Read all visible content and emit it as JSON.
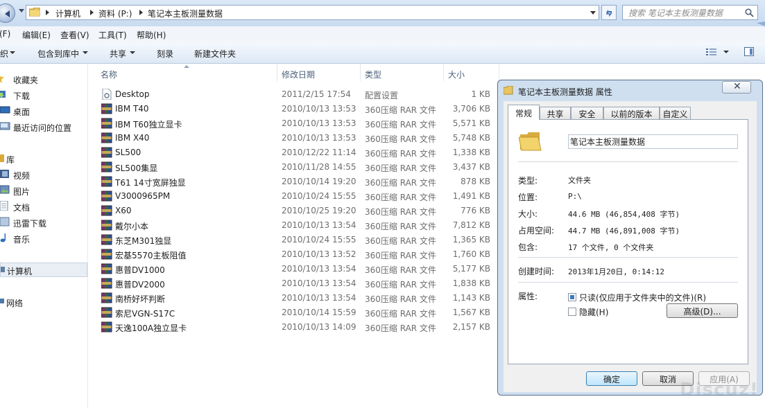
{
  "address_bar": {
    "crumbs": [
      "计算机",
      "资料 (P:)",
      "笔记本主板测量数据"
    ],
    "search_placeholder": "搜索 笔记本主板测量数据"
  },
  "menu": [
    "(F)",
    "编辑(E)",
    "查看(V)",
    "工具(T)",
    "帮助(H)"
  ],
  "commands": {
    "organize": "织",
    "include_in_library": "包含到库中",
    "share": "共享",
    "burn": "刻录",
    "new_folder": "新建文件夹"
  },
  "nav": {
    "favorites": "收藏夹",
    "downloads": "下载",
    "desktop": "桌面",
    "recent": "最近访问的位置",
    "libraries": "库",
    "videos": "视频",
    "pictures": "图片",
    "documents": "文档",
    "thunder": "迅雷下载",
    "music": "音乐",
    "computer": "计算机",
    "network": "网络"
  },
  "columns": {
    "name": "名称",
    "date": "修改日期",
    "type": "类型",
    "size": "大小"
  },
  "files": [
    {
      "name": "Desktop",
      "date": "2011/2/15 17:54",
      "type": "配置设置",
      "size": "1 KB",
      "icon": "settings-file"
    },
    {
      "name": "IBM T40",
      "date": "2010/10/13 13:53",
      "type": "360压缩 RAR 文件",
      "size": "3,706 KB",
      "icon": "rar"
    },
    {
      "name": "IBM T60独立显卡",
      "date": "2010/10/13 13:53",
      "type": "360压缩 RAR 文件",
      "size": "5,571 KB",
      "icon": "rar"
    },
    {
      "name": "IBM X40",
      "date": "2010/10/13 13:53",
      "type": "360压缩 RAR 文件",
      "size": "5,748 KB",
      "icon": "rar"
    },
    {
      "name": "SL500",
      "date": "2010/12/22 11:14",
      "type": "360压缩 RAR 文件",
      "size": "1,338 KB",
      "icon": "rar"
    },
    {
      "name": "SL500集显",
      "date": "2010/11/28 14:55",
      "type": "360压缩 RAR 文件",
      "size": "3,437 KB",
      "icon": "rar"
    },
    {
      "name": "T61 14寸宽屏独显",
      "date": "2010/10/14 19:20",
      "type": "360压缩 RAR 文件",
      "size": "878 KB",
      "icon": "rar"
    },
    {
      "name": "V3000965PM",
      "date": "2010/10/24 15:55",
      "type": "360压缩 RAR 文件",
      "size": "1,491 KB",
      "icon": "rar"
    },
    {
      "name": "X60",
      "date": "2010/10/25 19:20",
      "type": "360压缩 RAR 文件",
      "size": "776 KB",
      "icon": "rar"
    },
    {
      "name": "戴尔小本",
      "date": "2010/10/13 13:54",
      "type": "360压缩 RAR 文件",
      "size": "7,812 KB",
      "icon": "rar"
    },
    {
      "name": "东芝M301独显",
      "date": "2010/10/24 15:55",
      "type": "360压缩 RAR 文件",
      "size": "1,365 KB",
      "icon": "rar"
    },
    {
      "name": "宏基5570主板阻值",
      "date": "2010/10/13 13:52",
      "type": "360压缩 RAR 文件",
      "size": "1,760 KB",
      "icon": "rar"
    },
    {
      "name": "惠普DV1000",
      "date": "2010/10/13 13:54",
      "type": "360压缩 RAR 文件",
      "size": "5,177 KB",
      "icon": "rar"
    },
    {
      "name": "惠普DV2000",
      "date": "2010/10/13 13:54",
      "type": "360压缩 RAR 文件",
      "size": "1,838 KB",
      "icon": "rar"
    },
    {
      "name": "南桥好坏判断",
      "date": "2010/10/13 13:54",
      "type": "360压缩 RAR 文件",
      "size": "1,143 KB",
      "icon": "rar"
    },
    {
      "name": "索尼VGN-S17C",
      "date": "2010/10/14 15:59",
      "type": "360压缩 RAR 文件",
      "size": "1,567 KB",
      "icon": "rar"
    },
    {
      "name": "天逸100A独立显卡",
      "date": "2010/10/13 14:09",
      "type": "360压缩 RAR 文件",
      "size": "2,157 KB",
      "icon": "rar"
    }
  ],
  "dialog": {
    "title": "笔记本主板测量数据 属性",
    "tabs": [
      "常规",
      "共享",
      "安全",
      "以前的版本",
      "自定义"
    ],
    "folder_name": "笔记本主板测量数据",
    "type_label": "类型:",
    "type_value": "文件夹",
    "location_label": "位置:",
    "location_value": "P:\\",
    "size_label": "大小:",
    "size_value": "44.6 MB (46,854,408 字节)",
    "size_on_disk_label": "占用空间:",
    "size_on_disk_value": "44.7 MB (46,891,008 字节)",
    "contains_label": "包含:",
    "contains_value": "17 个文件, 0 个文件夹",
    "created_label": "创建时间:",
    "created_value": "2013年1月20日, 0:14:12",
    "attributes_label": "属性:",
    "readonly_label": "只读(仅应用于文件夹中的文件)(R)",
    "hidden_label": "隐藏(H)",
    "advanced_button": "高级(D)...",
    "ok_button": "确定",
    "cancel_button": "取消",
    "apply_button": "应用(A)"
  },
  "watermark": "Discuz!"
}
